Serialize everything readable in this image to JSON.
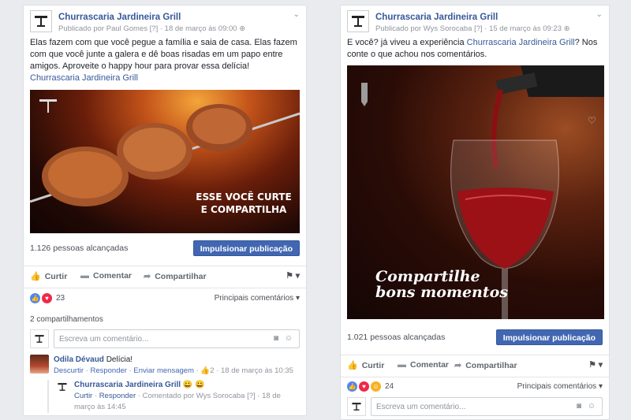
{
  "posts": [
    {
      "page_name": "Churrascaria Jardineira Grill",
      "published_by": "Publicado por Paul Gomes",
      "help_marker": "[?]",
      "timestamp": "18 de março às 09:00",
      "body_pre": "Elas fazem com que você pegue a família e saia de casa. Elas fazem com que você junte a galera e dê boas risadas em um papo entre amigos. Aproveite o happy hour para provar essa delícia! ",
      "body_link": "Churrascaria Jardineira Grill",
      "photo_caption": "ESSE VOCÊ CURTE E COMPARTILHA",
      "reach": "1.126 pessoas alcançadas",
      "boost": "Impulsionar publicação",
      "like": "Curtir",
      "comment": "Comentar",
      "share": "Compartilhar",
      "reaction_count": "23",
      "sort": "Principais comentários",
      "shares": "2 compartilhamentos",
      "comment_placeholder": "Escreva um comentário...",
      "comments": [
        {
          "author": "Odila Dévaud",
          "text": "Delícia!",
          "actions": [
            "Descurtir",
            "Responder",
            "Enviar mensagem"
          ],
          "likes": "2",
          "time": "18 de março às 10:35"
        }
      ],
      "reply": {
        "author": "Churrascaria Jardineira Grill",
        "emoji": "😀 😀",
        "actions": [
          "Curtir",
          "Responder"
        ],
        "meta": "Comentado por Wys Sorocaba [?] · 18 de março às 14:45"
      }
    },
    {
      "page_name": "Churrascaria Jardineira Grill",
      "published_by": "Publicado por Wys Sorocaba",
      "help_marker": "[?]",
      "timestamp": "15 de março às 09:23",
      "body_pre": "E você? já viveu a experiência ",
      "body_link": "Churrascaria Jardineira Grill",
      "body_post": "? Nos conte o que achou nos comentários.",
      "photo_caption_line1": "Compartilhe",
      "photo_caption_line2": "bons momentos",
      "reach": "1.021 pessoas alcançadas",
      "boost": "Impulsionar publicação",
      "like": "Curtir",
      "comment": "Comentar",
      "share": "Compartilhar",
      "reaction_count": "24",
      "sort": "Principais comentários",
      "comment_placeholder": "Escreva um comentário..."
    }
  ],
  "colors": {
    "link": "#365899",
    "boost": "#4267b2",
    "background": "#e9ebee"
  }
}
